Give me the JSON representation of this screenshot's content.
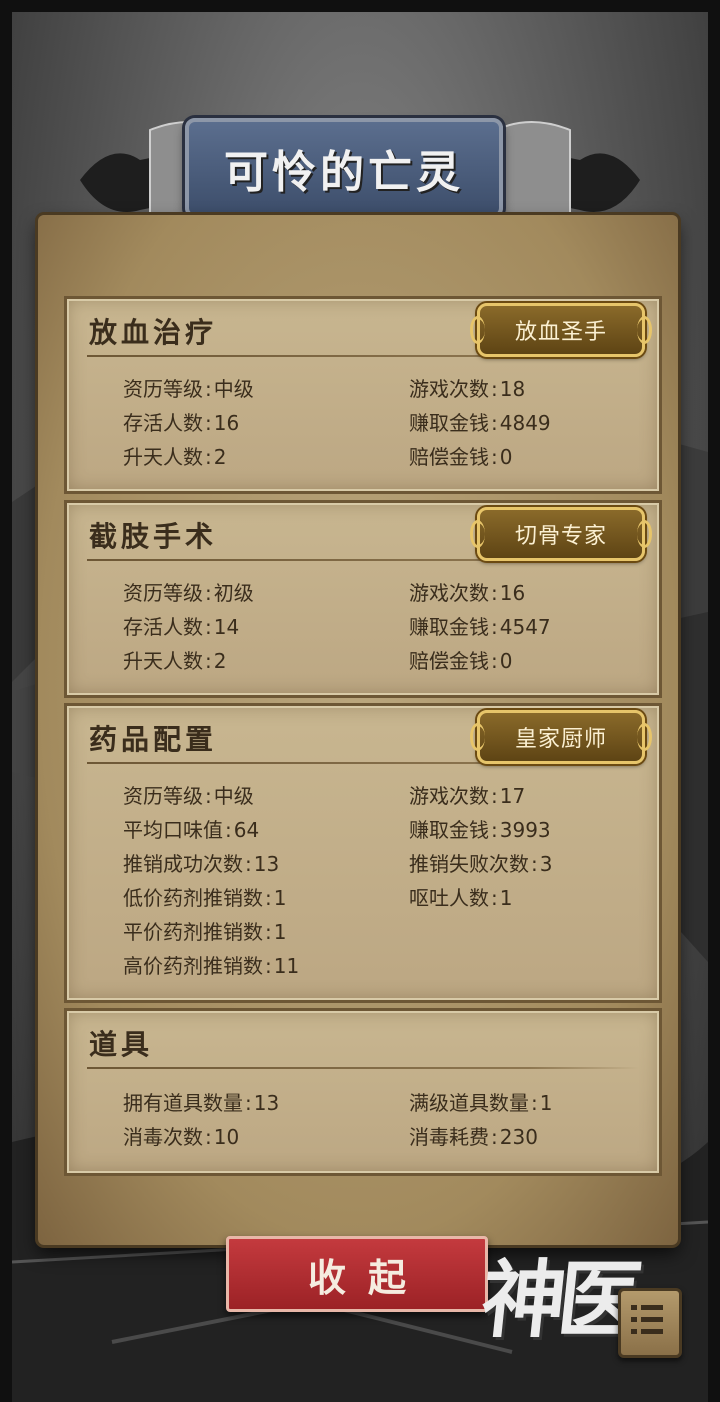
{
  "header": {
    "title": "可怜的亡灵"
  },
  "sections": [
    {
      "title": "放血治疗",
      "badge": "放血圣手",
      "left": [
        {
          "label": "资历等级",
          "value": "中级"
        },
        {
          "label": "存活人数",
          "value": "16"
        },
        {
          "label": "升天人数",
          "value": "2"
        }
      ],
      "right": [
        {
          "label": "游戏次数",
          "value": "18"
        },
        {
          "label": "赚取金钱",
          "value": "4849"
        },
        {
          "label": "赔偿金钱",
          "value": "0"
        }
      ]
    },
    {
      "title": "截肢手术",
      "badge": "切骨专家",
      "left": [
        {
          "label": "资历等级",
          "value": "初级"
        },
        {
          "label": "存活人数",
          "value": "14"
        },
        {
          "label": "升天人数",
          "value": "2"
        }
      ],
      "right": [
        {
          "label": "游戏次数",
          "value": "16"
        },
        {
          "label": "赚取金钱",
          "value": "4547"
        },
        {
          "label": "赔偿金钱",
          "value": "0"
        }
      ]
    },
    {
      "title": "药品配置",
      "badge": "皇家厨师",
      "left": [
        {
          "label": "资历等级",
          "value": "中级"
        },
        {
          "label": "平均口味值",
          "value": "64"
        },
        {
          "label": "推销成功次数",
          "value": "13"
        },
        {
          "label": "低价药剂推销数",
          "value": "1"
        },
        {
          "label": "平价药剂推销数",
          "value": "1"
        },
        {
          "label": "高价药剂推销数",
          "value": "11"
        }
      ],
      "right": [
        {
          "label": "游戏次数",
          "value": "17"
        },
        {
          "label": "赚取金钱",
          "value": "3993"
        },
        {
          "label": "推销失败次数",
          "value": "3"
        },
        {
          "label": "呕吐人数",
          "value": "1"
        }
      ]
    },
    {
      "title": "道具",
      "left": [
        {
          "label": "拥有道具数量",
          "value": "13"
        },
        {
          "label": "消毒次数",
          "value": "10"
        }
      ],
      "right": [
        {
          "label": "满级道具数量",
          "value": "1"
        },
        {
          "label": "消毒耗费",
          "value": "230"
        }
      ]
    }
  ],
  "footer": {
    "collapse_label": "收起",
    "logo_text": "神医",
    "menu_icon": "list-menu-icon"
  },
  "colors": {
    "parchment": "#b39f77",
    "text": "#3a2d1c",
    "badge_gold": "#e7c56a",
    "button_red": "#b42c30",
    "banner_blue": "#4a5c7c"
  }
}
